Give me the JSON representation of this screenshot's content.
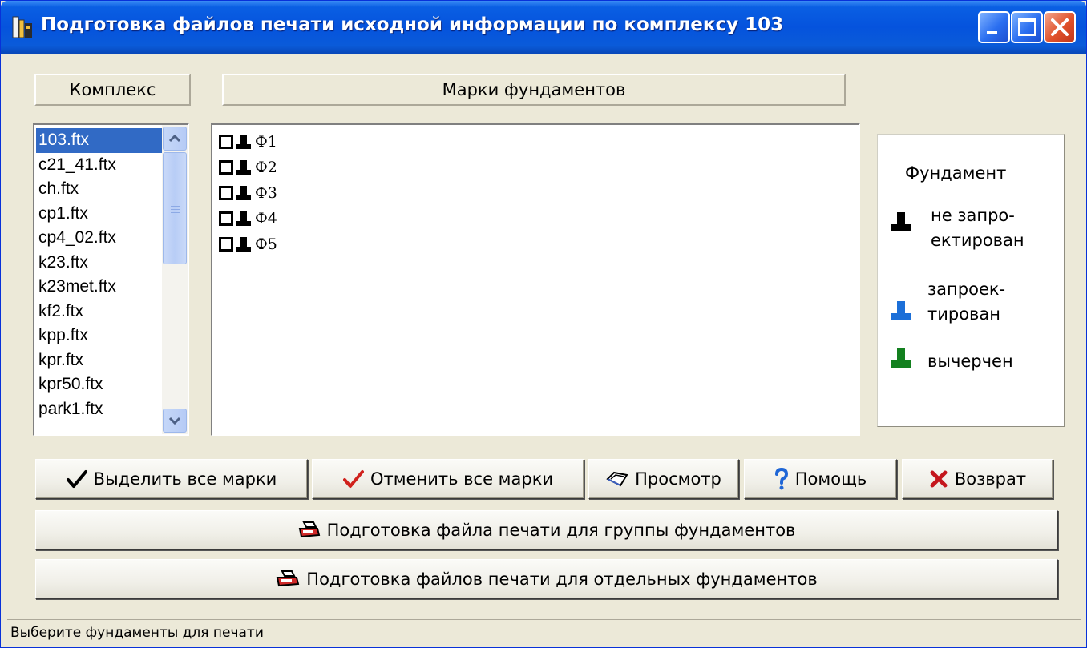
{
  "window": {
    "title": "Подготовка файлов печати исходной информации по комплексу 103"
  },
  "headers": {
    "complex": "Комплекс",
    "marks": "Марки фундаментов"
  },
  "file_list": {
    "items": [
      "103.ftx",
      "c21_41.ftx",
      "ch.ftx",
      "cp1.ftx",
      "cp4_02.ftx",
      "k23.ftx",
      "k23met.ftx",
      "kf2.ftx",
      "kpp.ftx",
      "kpr.ftx",
      "kpr50.ftx",
      "park1.ftx"
    ],
    "selected": "103.ftx"
  },
  "marks": [
    {
      "label": "Ф1",
      "checked": false,
      "status_color": "#000000"
    },
    {
      "label": "Ф2",
      "checked": false,
      "status_color": "#000000"
    },
    {
      "label": "Ф3",
      "checked": false,
      "status_color": "#000000"
    },
    {
      "label": "Ф4",
      "checked": false,
      "status_color": "#000000"
    },
    {
      "label": "Ф5",
      "checked": false,
      "status_color": "#000000"
    }
  ],
  "legend": {
    "title": "Фундамент",
    "items": [
      {
        "line1": "не запро-",
        "line2": "ектирован",
        "color": "#000000"
      },
      {
        "line1": "запроек-",
        "line2": "тирован",
        "color": "#1c6fd8"
      },
      {
        "line1": "вычерчен",
        "line2": "",
        "color": "#13801f"
      }
    ]
  },
  "buttons": {
    "select_all": "Выделить все марки",
    "deselect_all": "Отменить все марки",
    "preview": "Просмотр",
    "help": "Помощь",
    "back": "Возврат",
    "print_group": "Подготовка файла печати для группы фундаментов",
    "print_separate": "Подготовка файлов печати для отдельных фундаментов"
  },
  "colors": {
    "check_black": "#000000",
    "check_red": "#d0211c",
    "help_blue": "#1f66d6",
    "back_red": "#c4161c"
  },
  "status": "Выберите фундаменты для печати"
}
